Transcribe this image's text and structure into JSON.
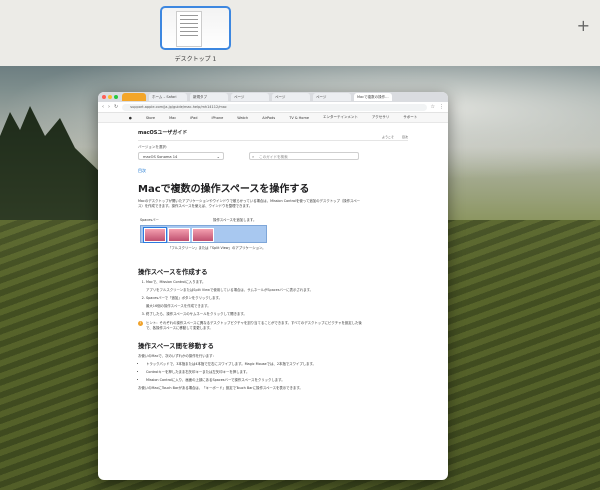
{
  "mission_control": {
    "desktop_label": "デスクトップ 1",
    "add_space": "+"
  },
  "browser": {
    "tabs": [
      "ニュース",
      "ホーム – Safari",
      "新規タブ",
      "ページ",
      "ページ",
      "ページ",
      "Macで複数の操作…"
    ],
    "first_tab": "",
    "url": "support.apple.com/ja-jp/guide/mac-help/mh14112/mac",
    "apple_nav": [
      "Store",
      "Mac",
      "iPad",
      "iPhone",
      "Watch",
      "AirPods",
      "TV & Home",
      "エンターテインメント",
      "アクセサリ",
      "サポート"
    ]
  },
  "page": {
    "guide_title": "macOSユーザガイド",
    "guide_links": [
      "ようこそ",
      "目次"
    ],
    "version_label": "バージョンを選択：",
    "version_value": "macOS Sonoma 14",
    "search_placeholder": "このガイドを検索",
    "toc_link": "目次",
    "title": "Macで複数の操作スペースを操作する",
    "intro": "Macのデスクトップが開いたアプリケーションやウインドウで散らかっている場合は、Mission Controlを使って追加のデスクトップ（操作スペース）を作成できます。操作スペースを使えば、ウインドウを整理できます。",
    "diagram_spaces_bar": "Spacesバー",
    "diagram_add": "操作スペースを追加します。",
    "diagram_caption": "「フルスクリーン」または「Split View」のアプリケーション。",
    "h_create": "操作スペースを作成する",
    "create_steps": [
      {
        "main": "Macで、Mission Controlに入ります。",
        "sub": "アプリをフルスクリーンまたはSplit Viewで使用している場合は、サムネールがSpacesバーに表示されます。"
      },
      {
        "main": "Spacesバーで「追加」ボタンをクリックします。",
        "sub": "最大16個の操作スペースを作成できます。"
      },
      {
        "main": "終了したら、操作スペースのサムネールをクリックして開きます。",
        "sub": ""
      }
    ],
    "tip": "ヒント：それぞれの操作スペースに異なるデスクトップピクチャを割り当てることができます。すべてのデスクトップにピクチャを設定した後で、各操作スペースに移動して変更します。",
    "h_move": "操作スペース間を移動する",
    "move_intro": "お使いのMacで、次のいずれかの操作を行います：",
    "move_items": [
      "トラックパッドで、3本指または4本指で左右にスワイプします。Magic Mouseでは、2本指でスワイプします。",
      "Controlキーを押したまま右矢印キーまたは左矢印キーを押します。",
      "Mission Controlに入り、画面の上部にあるSpacesバーで操作スペースをクリックします。"
    ],
    "move_footer": "お使いのMacにTouch Barがある場合は、「キーボード」設定でTouch Barに操作スペースを表示できます。"
  },
  "colors": {
    "accent": "#0066cc",
    "selected_space": "#3d87e0"
  }
}
